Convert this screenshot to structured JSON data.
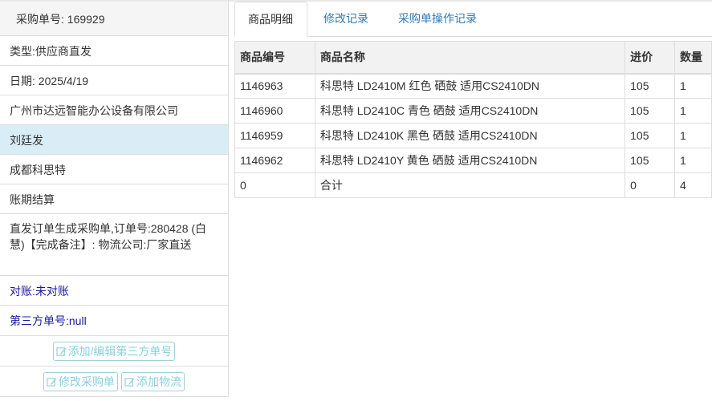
{
  "left": {
    "order_no": "采购单号: 169929",
    "type": "类型:供应商直发",
    "date": "日期: 2025/4/19",
    "supplier": "广州市达远智能办公设备有限公司",
    "person": "刘廷发",
    "city_company": "成都科思特",
    "payment": "账期结算",
    "remark": "直发订单生成采购单,订单号:280428 (白慧)【完成备注】: 物流公司:厂家直送",
    "reconcile": "对账:未对账",
    "third_party": "第三方单号:null",
    "btn_third_party": "添加/编辑第三方单号",
    "btn_edit_order": "修改采购单",
    "btn_add_logistics": "添加物流"
  },
  "tabs": [
    "商品明细",
    "修改记录",
    "采购单操作记录"
  ],
  "table": {
    "headers": [
      "商品编号",
      "商品名称",
      "进价",
      "数量"
    ],
    "rows": [
      [
        "1146963",
        "科思特 LD2410M 红色 硒鼓 适用CS2410DN",
        "105",
        "1"
      ],
      [
        "1146960",
        "科思特 LD2410C 青色 硒鼓 适用CS2410DN",
        "105",
        "1"
      ],
      [
        "1146959",
        "科思特 LD2410K 黑色 硒鼓 适用CS2410DN",
        "105",
        "1"
      ],
      [
        "1146962",
        "科思特 LD2410Y 黄色 硒鼓 适用CS2410DN",
        "105",
        "1"
      ],
      [
        "0",
        "合计",
        "0",
        "4"
      ]
    ]
  },
  "colors": {
    "selected_row": "#d9edf7",
    "link": "#337ab7",
    "button_text": "#8ad0dc"
  },
  "icons": {
    "button_icon": "edit-pen-icon"
  }
}
